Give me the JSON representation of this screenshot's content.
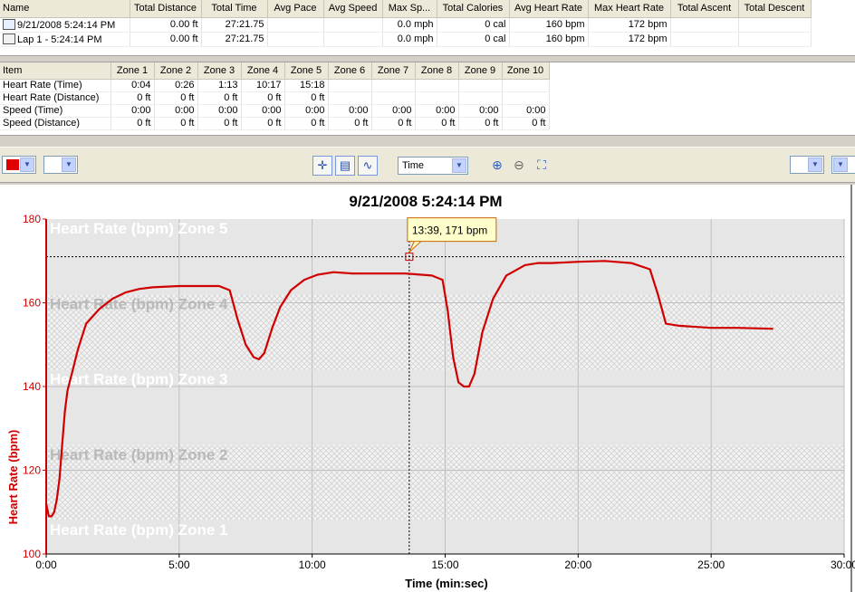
{
  "summary": {
    "columns": [
      "Name",
      "Total Distance",
      "Total Time",
      "Avg Pace",
      "Avg Speed",
      "Max Sp...",
      "Total Calories",
      "Avg Heart Rate",
      "Max Heart Rate",
      "Total Ascent",
      "Total Descent"
    ],
    "rows": [
      {
        "icon": "activity-icon",
        "cells": [
          "9/21/2008 5:24:14 PM",
          "0.00 ft",
          "27:21.75",
          "",
          "",
          "0.0 mph",
          "0 cal",
          "160 bpm",
          "172 bpm",
          "",
          ""
        ]
      },
      {
        "icon": "lap-icon",
        "cells": [
          "Lap 1 - 5:24:14 PM",
          "0.00 ft",
          "27:21.75",
          "",
          "",
          "0.0 mph",
          "0 cal",
          "160 bpm",
          "172 bpm",
          "",
          ""
        ]
      }
    ]
  },
  "zones": {
    "columns": [
      "Item",
      "Zone 1",
      "Zone 2",
      "Zone 3",
      "Zone 4",
      "Zone 5",
      "Zone 6",
      "Zone 7",
      "Zone 8",
      "Zone 9",
      "Zone 10"
    ],
    "rows": [
      [
        "Heart Rate (Time)",
        "0:04",
        "0:26",
        "1:13",
        "10:17",
        "15:18",
        "",
        "",
        "",
        "",
        ""
      ],
      [
        "Heart Rate (Distance)",
        "0 ft",
        "0 ft",
        "0 ft",
        "0 ft",
        "0 ft",
        "",
        "",
        "",
        "",
        ""
      ],
      [
        "Speed (Time)",
        "0:00",
        "0:00",
        "0:00",
        "0:00",
        "0:00",
        "0:00",
        "0:00",
        "0:00",
        "0:00",
        "0:00"
      ],
      [
        "Speed (Distance)",
        "0 ft",
        "0 ft",
        "0 ft",
        "0 ft",
        "0 ft",
        "0 ft",
        "0 ft",
        "0 ft",
        "0 ft",
        "0 ft"
      ]
    ]
  },
  "toolbar": {
    "color_value": "#e00000",
    "xaxis_select": "Time",
    "icons": [
      "crosshair-icon",
      "fit-icon",
      "smooth-icon",
      "zoom-in-icon",
      "zoom-out-icon",
      "zoom-fit-icon"
    ]
  },
  "chart_data": {
    "type": "line",
    "title": "9/21/2008 5:24:14 PM",
    "xlabel": "Time (min:sec)",
    "ylabel": "Heart Rate (bpm)",
    "xlim": [
      0,
      30
    ],
    "ylim": [
      100,
      180
    ],
    "x_ticks": [
      "0:00",
      "5:00",
      "10:00",
      "15:00",
      "20:00",
      "25:00",
      "30:00"
    ],
    "y_ticks": [
      "100",
      "120",
      "140",
      "160",
      "180"
    ],
    "line_color": "#d00000",
    "grid": true,
    "zones": [
      {
        "label": "Heart Rate (bpm) Zone 5",
        "from": 162,
        "to": 180,
        "pattern": "solid"
      },
      {
        "label": "Heart Rate (bpm) Zone 4",
        "from": 144,
        "to": 162,
        "pattern": "hatched"
      },
      {
        "label": "Heart Rate (bpm) Zone 3",
        "from": 126,
        "to": 144,
        "pattern": "solid"
      },
      {
        "label": "Heart Rate (bpm) Zone 2",
        "from": 108,
        "to": 126,
        "pattern": "hatched"
      },
      {
        "label": "Heart Rate (bpm) Zone 1",
        "from": 100,
        "to": 108,
        "pattern": "solid"
      }
    ],
    "tooltip": {
      "text": "13:39, 171 bpm",
      "x": 13.65,
      "y": 171
    },
    "x": [
      0.0,
      0.1,
      0.2,
      0.3,
      0.4,
      0.5,
      0.6,
      0.7,
      0.8,
      1.0,
      1.2,
      1.5,
      2.0,
      2.5,
      3.0,
      3.5,
      4.0,
      5.0,
      6.0,
      6.5,
      6.9,
      7.2,
      7.5,
      7.8,
      8.0,
      8.2,
      8.5,
      8.8,
      9.2,
      9.7,
      10.2,
      10.8,
      11.5,
      12.5,
      13.5,
      14.5,
      14.9,
      15.1,
      15.3,
      15.5,
      15.7,
      15.9,
      16.1,
      16.4,
      16.8,
      17.3,
      18.0,
      18.5,
      19.0,
      20.0,
      21.0,
      22.0,
      22.7,
      23.0,
      23.3,
      23.8,
      25.0,
      26.0,
      27.3
    ],
    "y": [
      112,
      109,
      109,
      110,
      113,
      118,
      126,
      134,
      139,
      144,
      149,
      155,
      158.5,
      161,
      162.5,
      163.3,
      163.7,
      164,
      164,
      164,
      163,
      156,
      150,
      147,
      146.5,
      148,
      154,
      159,
      163,
      165.5,
      166.7,
      167.3,
      167,
      167,
      167,
      166.5,
      165.5,
      158,
      147,
      141,
      140,
      140,
      143,
      153,
      161,
      166.5,
      169,
      169.5,
      169.5,
      169.8,
      170,
      169.5,
      168,
      162,
      155,
      154.5,
      154,
      154,
      153.8
    ]
  }
}
